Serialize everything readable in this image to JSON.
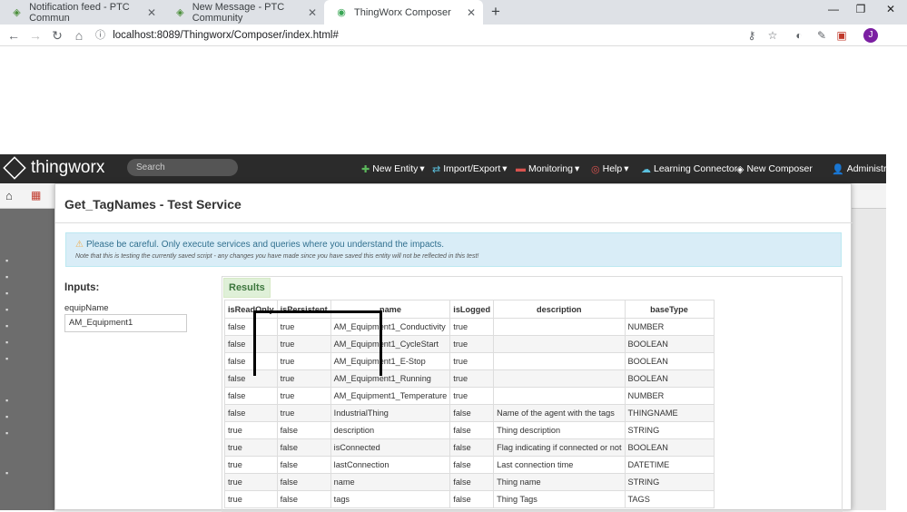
{
  "browser": {
    "tabs": [
      {
        "title": "Notification feed - PTC Commun"
      },
      {
        "title": "New Message - PTC Community"
      },
      {
        "title": "ThingWorx Composer"
      }
    ],
    "new_tab": "+",
    "url": "localhost:8089/Thingworx/Composer/index.html#"
  },
  "thingworx": {
    "logo_text": "thingworx",
    "search_placeholder": "Search",
    "menu": {
      "new_entity": "New Entity",
      "import_export": "Import/Export",
      "monitoring": "Monitoring",
      "help": "Help",
      "learning_connector": "Learning Connector",
      "new_composer": "New Composer",
      "user": "Administrat"
    }
  },
  "modal": {
    "title": "Get_TagNames - Test Service",
    "warning": "Please be careful. Only execute services and queries where you understand the impacts.",
    "warning_note": "Note that this is testing the currently saved script - any changes you have made since you have saved this entity will not be reflected in this test!",
    "inputs_label": "Inputs:",
    "param_label": "equipName",
    "param_value": "AM_Equipment1",
    "results_label": "Results"
  },
  "results_table": {
    "headers": [
      "isReadOnly",
      "isPersistent",
      "name",
      "isLogged",
      "description",
      "baseType"
    ],
    "rows": [
      [
        "false",
        "true",
        "AM_Equipment1_Conductivity",
        "true",
        "",
        "NUMBER"
      ],
      [
        "false",
        "true",
        "AM_Equipment1_CycleStart",
        "true",
        "",
        "BOOLEAN"
      ],
      [
        "false",
        "true",
        "AM_Equipment1_E-Stop",
        "true",
        "",
        "BOOLEAN"
      ],
      [
        "false",
        "true",
        "AM_Equipment1_Running",
        "true",
        "",
        "BOOLEAN"
      ],
      [
        "false",
        "true",
        "AM_Equipment1_Temperature",
        "true",
        "",
        "NUMBER"
      ],
      [
        "false",
        "true",
        "IndustrialThing",
        "false",
        "Name of the agent with the tags",
        "THINGNAME"
      ],
      [
        "true",
        "false",
        "description",
        "false",
        "Thing description",
        "STRING"
      ],
      [
        "true",
        "false",
        "isConnected",
        "false",
        "Flag indicating if connected or not",
        "BOOLEAN"
      ],
      [
        "true",
        "false",
        "lastConnection",
        "false",
        "Last connection time",
        "DATETIME"
      ],
      [
        "true",
        "false",
        "name",
        "false",
        "Thing name",
        "STRING"
      ],
      [
        "true",
        "false",
        "tags",
        "false",
        "Thing Tags",
        "TAGS"
      ]
    ]
  }
}
